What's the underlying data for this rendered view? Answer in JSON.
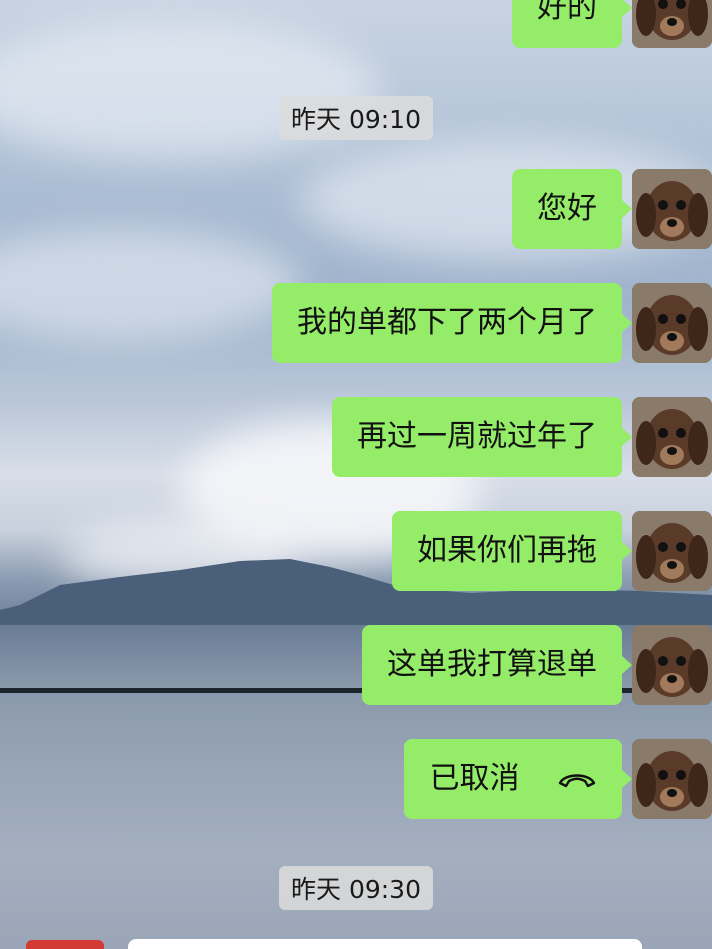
{
  "timestamps": {
    "first": "昨天 09:10",
    "second": "昨天 09:30"
  },
  "messages": [
    {
      "text": "好的"
    },
    {
      "text": "您好"
    },
    {
      "text": "我的单都下了两个月了"
    },
    {
      "text": "再过一周就过年了"
    },
    {
      "text": "如果你们再拖"
    },
    {
      "text": "这单我打算退单"
    },
    {
      "text": "已取消",
      "icon": "phone-hangup-icon"
    }
  ],
  "colors": {
    "bubble": "#95ec69",
    "timestamp_bg": "#dcdcdc"
  }
}
